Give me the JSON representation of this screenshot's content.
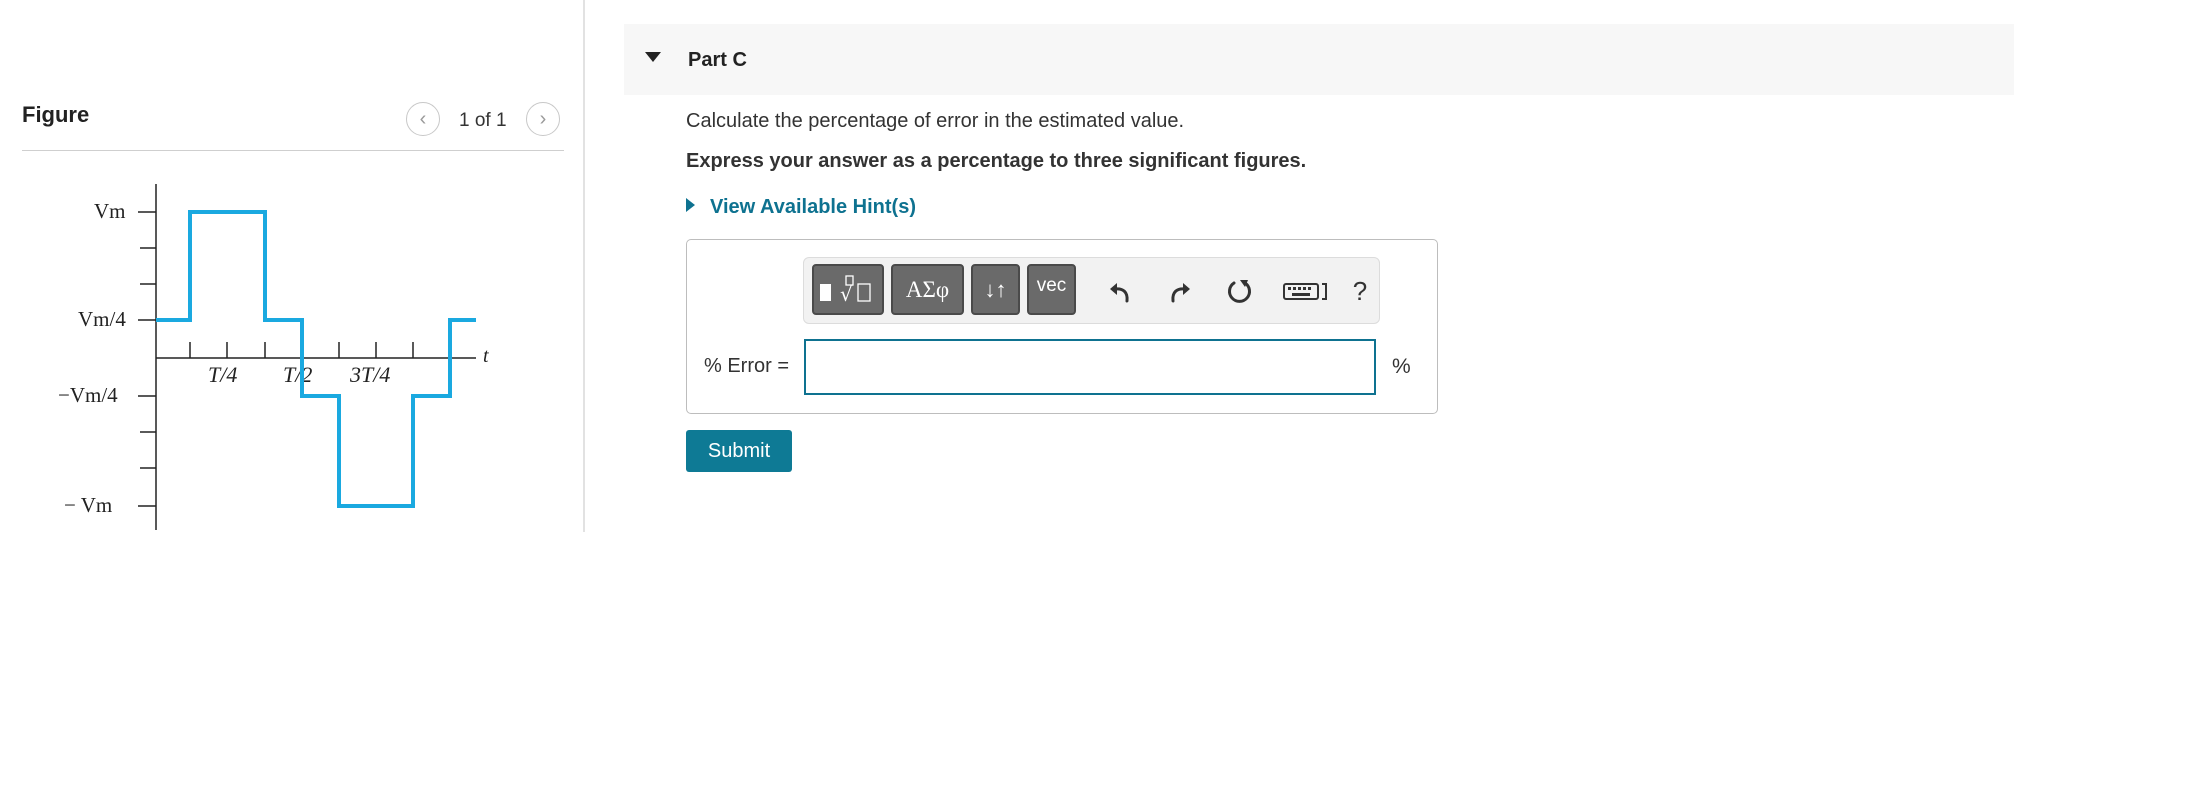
{
  "figure": {
    "title": "Figure",
    "pager": "1 of 1",
    "prev_icon": "chevron-left-icon",
    "next_icon": "chevron-right-icon",
    "waveform": {
      "y_labels": [
        "Vm",
        "Vm/4",
        "−Vm/4",
        "− Vm"
      ],
      "x_labels": [
        "T/4",
        "T/2",
        "3T/4"
      ],
      "axis_label": "t",
      "line_color": "#1aa9e0"
    }
  },
  "part": {
    "title": "Part C",
    "instruction": "Calculate the percentage of error in the estimated value.",
    "instruction_bold": "Express your answer as a percentage to three significant figures.",
    "hint_link": "View Available Hint(s)"
  },
  "toolbar": {
    "templates_icon": "templates-icon",
    "greek_label": "ΑΣφ",
    "arrows_label": "↓↑",
    "vec_label": "vec",
    "undo_icon": "undo-icon",
    "redo_icon": "redo-icon",
    "reset_icon": "reset-icon",
    "keyboard_icon": "keyboard-icon",
    "help_label": "?"
  },
  "answer": {
    "label": "% Error =",
    "value": "",
    "unit": "%"
  },
  "submit_label": "Submit",
  "colors": {
    "accent": "#0e7290",
    "submit_bg": "#0e7a95",
    "toolbar_button": "#6a6a6a"
  }
}
